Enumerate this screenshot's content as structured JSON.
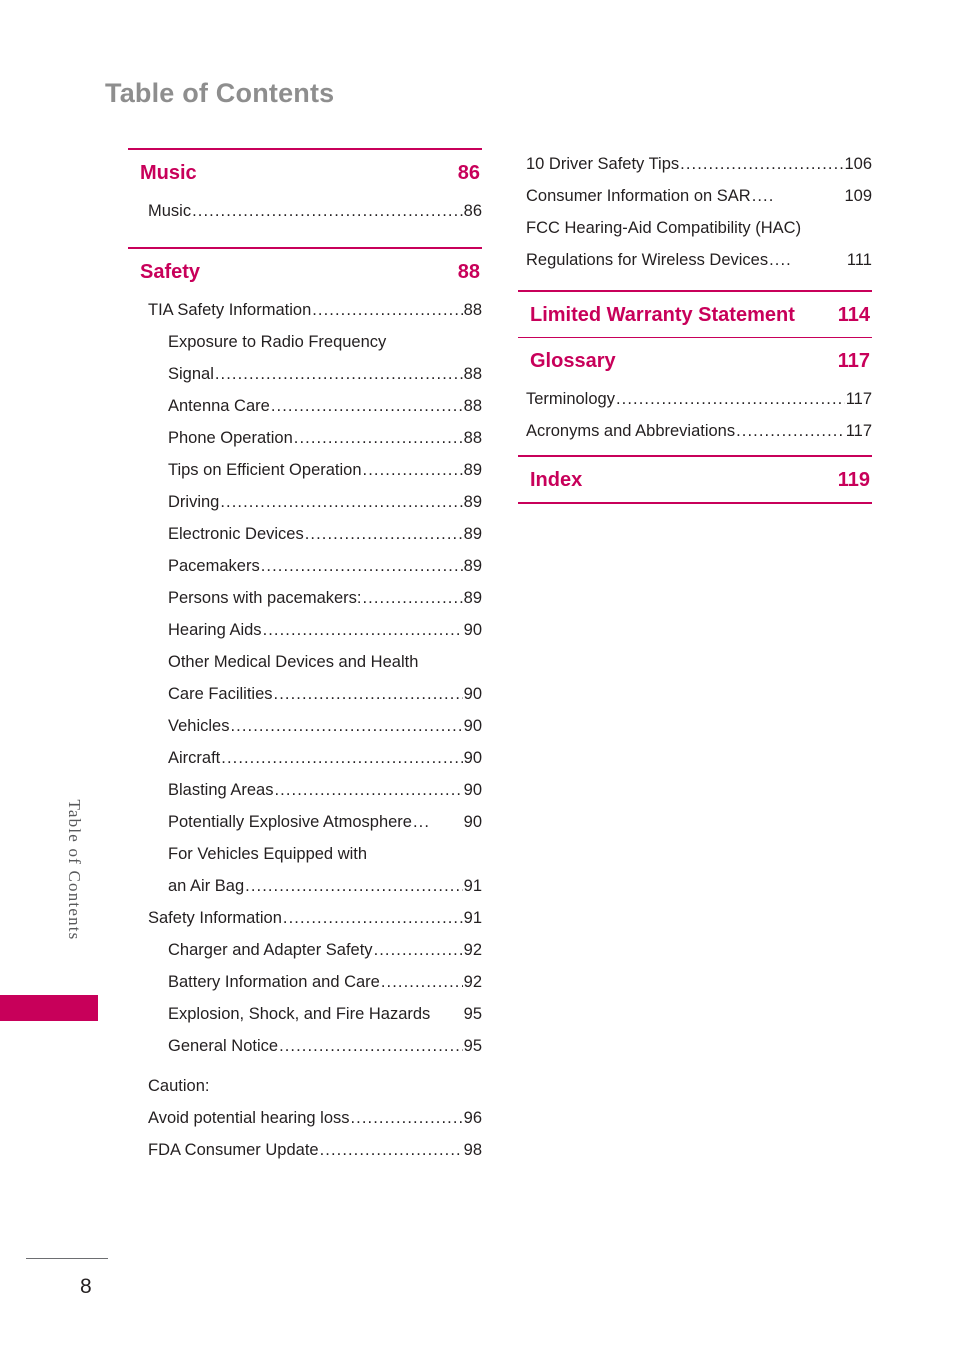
{
  "document": {
    "title": "Table of Contents",
    "side_tab": "Table of Contents",
    "page_number": "8"
  },
  "left_column": {
    "sections": [
      {
        "heading": "Music",
        "page": "86",
        "entries": [
          {
            "label": "Music",
            "page": "86",
            "level": 1,
            "dots": true
          }
        ]
      },
      {
        "heading": "Safety",
        "page": "88",
        "entries": [
          {
            "label": "TIA Safety Information",
            "page": "88",
            "level": 1,
            "dots": true
          },
          {
            "label": "Exposure to Radio Frequency",
            "page": "",
            "level": 2,
            "dots": false
          },
          {
            "label": "Signal",
            "page": "88",
            "level": 2,
            "dots": true
          },
          {
            "label": "Antenna Care",
            "page": "88",
            "level": 2,
            "dots": true
          },
          {
            "label": "Phone Operation",
            "page": "88",
            "level": 2,
            "dots": true
          },
          {
            "label": "Tips on Efficient Operation",
            "page": "89",
            "level": 2,
            "dots": true
          },
          {
            "label": "Driving",
            "page": "89",
            "level": 2,
            "dots": true
          },
          {
            "label": "Electronic Devices",
            "page": "89",
            "level": 2,
            "dots": true
          },
          {
            "label": "Pacemakers",
            "page": "89",
            "level": 2,
            "dots": true
          },
          {
            "label": "Persons with pacemakers:",
            "page": "89",
            "level": 2,
            "dots": true
          },
          {
            "label": "Hearing Aids",
            "page": "90",
            "level": 2,
            "dots": true
          },
          {
            "label": "Other Medical Devices and Health",
            "page": "",
            "level": 2,
            "dots": false
          },
          {
            "label": "Care Facilities",
            "page": "90",
            "level": 2,
            "dots": true
          },
          {
            "label": "Vehicles",
            "page": "90",
            "level": 2,
            "dots": true
          },
          {
            "label": "Aircraft",
            "page": "90",
            "level": 2,
            "dots": true
          },
          {
            "label": "Blasting Areas",
            "page": "90",
            "level": 2,
            "dots": true
          },
          {
            "label": "Potentially Explosive Atmosphere",
            "page": "90",
            "level": 2,
            "dots": true
          },
          {
            "label": "For Vehicles Equipped with",
            "page": "",
            "level": 2,
            "dots": false
          },
          {
            "label": "an Air Bag",
            "page": "91",
            "level": 2,
            "dots": true
          },
          {
            "label": "Safety Information",
            "page": "91",
            "level": 1,
            "dots": true
          },
          {
            "label": "Charger and Adapter Safety",
            "page": "92",
            "level": 2,
            "dots": true
          },
          {
            "label": "Battery Information and Care",
            "page": "92",
            "level": 2,
            "dots": true
          },
          {
            "label": "Explosion, Shock, and Fire Hazards",
            "page": "95",
            "level": 2,
            "dots": false
          },
          {
            "label": "General Notice",
            "page": "95",
            "level": 2,
            "dots": true
          },
          {
            "label": "Caution:",
            "page": "",
            "level": 1,
            "dots": false
          },
          {
            "label": "Avoid potential hearing loss",
            "page": "96",
            "level": 1,
            "dots": true
          },
          {
            "label": "FDA Consumer Update",
            "page": "98",
            "level": 1,
            "dots": true
          }
        ]
      }
    ]
  },
  "right_column": {
    "top_entries": [
      {
        "label": "10 Driver Safety Tips",
        "page": "106",
        "level": 1,
        "dots": true
      },
      {
        "label": "Consumer Information on SAR",
        "page": "109",
        "level": 1,
        "dots": true
      },
      {
        "label": "FCC Hearing-Aid Compatibility (HAC)",
        "page": "",
        "level": 1,
        "dots": false
      },
      {
        "label": "Regulations for Wireless Devices",
        "page": "111",
        "level": 1,
        "dots": true
      }
    ],
    "sections": [
      {
        "heading": "Limited Warranty Statement",
        "page": "114",
        "entries": []
      },
      {
        "heading": "Glossary",
        "page": "117",
        "entries": [
          {
            "label": "Terminology",
            "page": "117",
            "level": 1,
            "dots": true
          },
          {
            "label": "Acronyms and Abbreviations",
            "page": "117",
            "level": 1,
            "dots": true
          }
        ]
      },
      {
        "heading": "Index",
        "page": "119",
        "entries": []
      }
    ]
  },
  "colors": {
    "accent": "#c8005a",
    "title_gray": "#8e8e8e",
    "text": "#231f20"
  }
}
